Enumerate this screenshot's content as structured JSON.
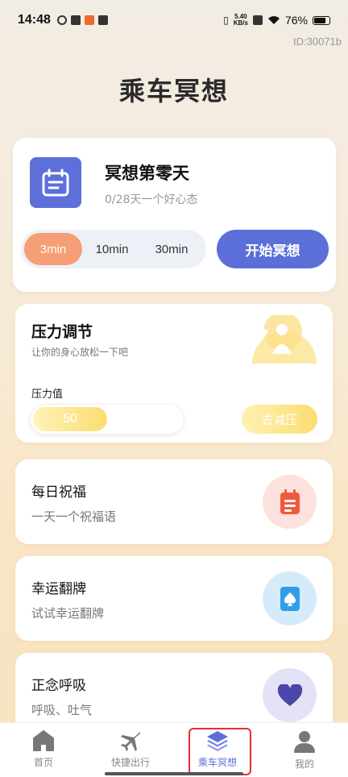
{
  "status_bar": {
    "time": "14:48",
    "net_speed_top": "5.40",
    "net_speed_bottom": "KB/s",
    "battery": "76%"
  },
  "id_label": "ID:30071b",
  "page_title": "乘车冥想",
  "meditation": {
    "title": "冥想第零天",
    "subtitle": "0/28天一个好心态",
    "durations": [
      "3min",
      "10min",
      "30min"
    ],
    "selected_duration": "3min",
    "start_button": "开始冥想",
    "accent": "#5c6fd8",
    "active_color": "#f69e75"
  },
  "pressure": {
    "title": "压力调节",
    "subtitle": "让你的身心放松一下吧",
    "label": "压力值",
    "value": "50",
    "level_fraction": 0.5,
    "button": "去减压"
  },
  "features": [
    {
      "title": "每日祝福",
      "subtitle": "一天一个祝福语",
      "icon": "calendar-note-icon",
      "circle_color": "#fde1dc",
      "icon_color": "#ef5a3e"
    },
    {
      "title": "幸运翻牌",
      "subtitle": "试试幸运翻牌",
      "icon": "spade-card-icon",
      "circle_color": "#d5ebfa",
      "icon_color": "#2f9de8"
    },
    {
      "title": "正念呼吸",
      "subtitle": "呼吸、吐气",
      "icon": "heart-icon",
      "circle_color": "#e4e2f6",
      "icon_color": "#4a47a8"
    }
  ],
  "tabs": [
    {
      "label": "首页",
      "icon": "home-icon"
    },
    {
      "label": "快捷出行",
      "icon": "airplane-icon"
    },
    {
      "label": "乘车冥想",
      "icon": "layers-icon"
    },
    {
      "label": "我的",
      "icon": "user-icon"
    }
  ],
  "active_tab": "乘车冥想"
}
